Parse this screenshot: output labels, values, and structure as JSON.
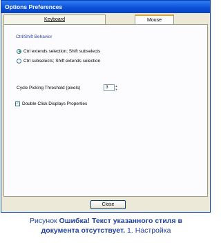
{
  "window": {
    "title": "Options Preferences"
  },
  "tabs": {
    "keyboard": "Keyboard",
    "mouse": "Mouse"
  },
  "mouse_tab": {
    "group_title": "Ctrl/Shift Behavior",
    "options": [
      {
        "label": "Ctrl extends selection; Shift subselects",
        "selected": true
      },
      {
        "label": "Ctrl subselects; Shift extends selection",
        "selected": false
      }
    ],
    "threshold_label": "Cycle Picking Threshold (pixels)",
    "threshold_value": "3",
    "double_click_label": "Double Click Displays Properties",
    "double_click_checked": true
  },
  "footer": {
    "close_label": "Close"
  },
  "caption": {
    "line1_prefix": "Рисунок ",
    "line1_error": "Ошибка! Текст указанного стиля в",
    "line2_error": "документа отсутствует.",
    "line2_suffix": " 1. Настройка"
  },
  "colors": {
    "title_bar": "#0a4fd6",
    "dialog_bg": "#ece9d8",
    "tab_active_accent": "#e6a21f",
    "group_title_text": "#2a3eb1",
    "radio_selected": "#2a9e2a",
    "caption_text": "#1f3fa3"
  }
}
